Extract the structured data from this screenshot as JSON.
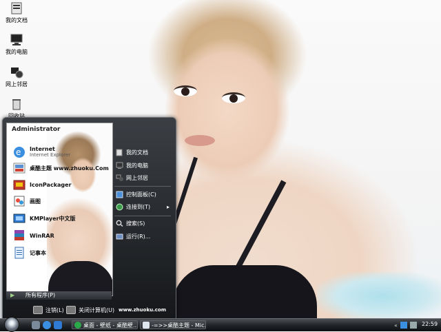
{
  "desktop": {
    "icons": [
      {
        "label": "我的文档",
        "icon": "my-documents-icon"
      },
      {
        "label": "我的电脑",
        "icon": "my-computer-icon"
      },
      {
        "label": "网上邻居",
        "icon": "network-places-icon"
      },
      {
        "label": "回收站",
        "icon": "recycle-bin-icon"
      }
    ]
  },
  "start_menu": {
    "user_name": "Administrator",
    "pinned": [
      {
        "name": "Internet",
        "subtitle": "Internet Explorer",
        "icon": "internet-explorer-icon"
      },
      {
        "name": "桌酷主题 www.zhuoku.Com",
        "icon": "zhuoku-theme-icon"
      },
      {
        "name": "IconPackager",
        "icon": "iconpackager-icon"
      },
      {
        "name": "画图",
        "icon": "paint-icon"
      },
      {
        "name": "KMPlayer中文版",
        "icon": "kmplayer-icon"
      },
      {
        "name": "WinRAR",
        "icon": "winrar-icon"
      },
      {
        "name": "记事本",
        "icon": "notepad-icon"
      }
    ],
    "all_programs_label": "所有程序(P)",
    "right_items": [
      {
        "label": "我的文档",
        "icon": "my-documents-icon"
      },
      {
        "label": "我的电脑",
        "icon": "my-computer-icon"
      },
      {
        "label": "网上邻居",
        "icon": "network-places-icon"
      },
      {
        "label": "控制面板(C)",
        "icon": "control-panel-icon"
      },
      {
        "label": "连接到(T)",
        "icon": "connect-to-icon"
      },
      {
        "label": "搜索(S)",
        "icon": "search-icon"
      },
      {
        "label": "运行(R)...",
        "icon": "run-icon"
      }
    ],
    "logoff_label": "注销(L)",
    "shutdown_label": "关闭计算机(U)",
    "website": "www.zhuoku.com"
  },
  "taskbar": {
    "buttons": [
      {
        "label": "桌面 - 壁纸 - 桌酷壁..."
      },
      {
        "label": "-=>>桌酷主题 - Mic..."
      }
    ],
    "clock": "22:59"
  },
  "colors": {
    "taskbar": "#1e2124",
    "menu_dark": "#15171a"
  }
}
